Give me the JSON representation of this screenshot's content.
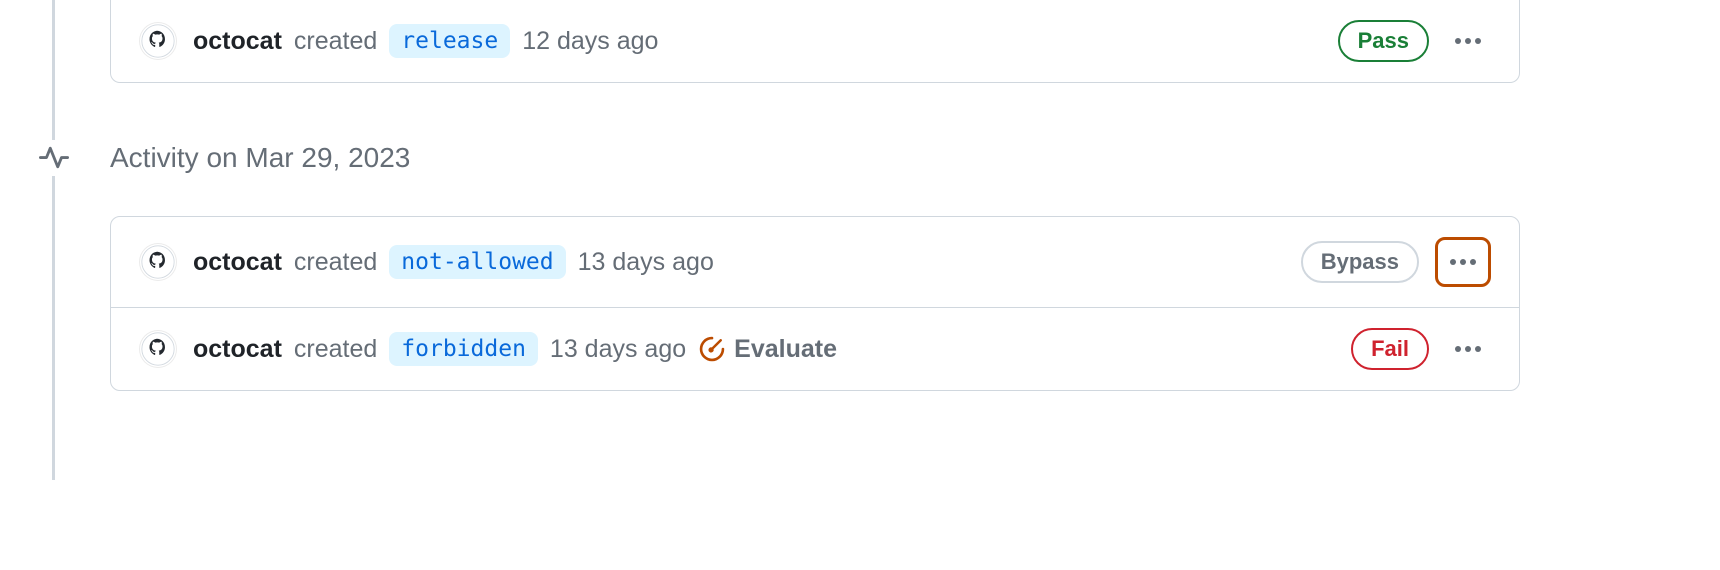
{
  "sections": [
    {
      "header": null,
      "items": [
        {
          "user": "octocat",
          "action": "created",
          "branch": "release",
          "timestamp": "12 days ago",
          "evaluate": false,
          "status": {
            "label": "Pass",
            "variant": "pass"
          },
          "kebab_highlighted": false
        }
      ]
    },
    {
      "header": "Activity on Mar 29, 2023",
      "items": [
        {
          "user": "octocat",
          "action": "created",
          "branch": "not-allowed",
          "timestamp": "13 days ago",
          "evaluate": false,
          "status": {
            "label": "Bypass",
            "variant": "bypass"
          },
          "kebab_highlighted": true
        },
        {
          "user": "octocat",
          "action": "created",
          "branch": "forbidden",
          "timestamp": "13 days ago",
          "evaluate": true,
          "evaluate_label": "Evaluate",
          "status": {
            "label": "Fail",
            "variant": "fail"
          },
          "kebab_highlighted": false
        }
      ]
    }
  ]
}
